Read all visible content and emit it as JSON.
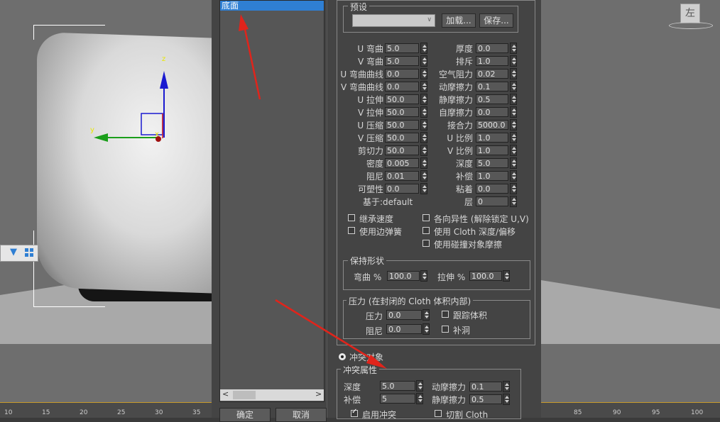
{
  "list": {
    "selected_item": "底面"
  },
  "preset": {
    "title": "预设",
    "dropdown_value": "",
    "load_label": "加载...",
    "save_label": "保存..."
  },
  "params_left": [
    {
      "label": "U 弯曲",
      "value": "5.0"
    },
    {
      "label": "V 弯曲",
      "value": "5.0"
    },
    {
      "label": "U 弯曲曲线",
      "value": "0.0"
    },
    {
      "label": "V 弯曲曲线",
      "value": "0.0"
    },
    {
      "label": "U 拉伸",
      "value": "50.0"
    },
    {
      "label": "V 拉伸",
      "value": "50.0"
    },
    {
      "label": "U 压缩",
      "value": "50.0"
    },
    {
      "label": "V 压缩",
      "value": "50.0"
    },
    {
      "label": "剪切力",
      "value": "50.0"
    },
    {
      "label": "密度",
      "value": "0.005"
    },
    {
      "label": "阻尼",
      "value": "0.01"
    },
    {
      "label": "可塑性",
      "value": "0.0"
    }
  ],
  "params_right": [
    {
      "label": "厚度",
      "value": "0.0"
    },
    {
      "label": "排斥",
      "value": "1.0"
    },
    {
      "label": "空气阻力",
      "value": "0.02"
    },
    {
      "label": "动摩擦力",
      "value": "0.1"
    },
    {
      "label": "静摩擦力",
      "value": "0.5"
    },
    {
      "label": "自摩擦力",
      "value": "0.0"
    },
    {
      "label": "接合力",
      "value": "5000.0"
    },
    {
      "label": "U 比例",
      "value": "1.0"
    },
    {
      "label": "V 比例",
      "value": "1.0"
    },
    {
      "label": "深度",
      "value": "5.0"
    },
    {
      "label": "补偿",
      "value": "1.0"
    },
    {
      "label": "粘着",
      "value": "0.0"
    },
    {
      "label": "层",
      "value": "0"
    }
  ],
  "based_on": "基于:default",
  "checks": {
    "inherit_velocity": "继承速度",
    "use_edge_springs": "使用边弹簧",
    "anisotropic": "各向异性 (解除锁定 U,V)",
    "use_cloth_depth": "使用 Cloth 深度/偏移",
    "use_collider_friction": "使用碰撞对象摩擦"
  },
  "keep_shape": {
    "title": "保持形状",
    "bend_label": "弯曲 %",
    "bend_value": "100.0",
    "stretch_label": "拉伸 %",
    "stretch_value": "100.0"
  },
  "pressure": {
    "title": "压力 (在封闭的 Cloth 体积内部)",
    "pressure_label": "压力",
    "pressure_value": "0.0",
    "damping_label": "阻尼",
    "damping_value": "0.0",
    "track_volume": "跟踪体积",
    "cap_holes": "补洞"
  },
  "collision": {
    "radio_label": "冲突对象",
    "title": "冲突属性",
    "depth_label": "深度",
    "depth_value": "5.0",
    "offset_label": "补偿",
    "offset_value": "5",
    "dyn_friction_label": "动摩擦力",
    "dyn_friction_value": "0.1",
    "static_friction_label": "静摩擦力",
    "static_friction_value": "0.5",
    "enable_collision": "启用冲突",
    "cut_cloth": "切割 Cloth"
  },
  "buttons": {
    "ok": "确定",
    "cancel": "取消"
  },
  "viewport": {
    "axis_x": "x",
    "axis_y": "y",
    "axis_z": "z",
    "viewcube_label": "左",
    "ruler_left": [
      "10",
      "15",
      "20",
      "25",
      "30",
      "35"
    ],
    "ruler_right": [
      "85",
      "90",
      "95",
      "100"
    ]
  },
  "colors": {
    "accent": "#2f7fd3",
    "arrow": "#e0241b",
    "dialog_bg": "#444444"
  }
}
